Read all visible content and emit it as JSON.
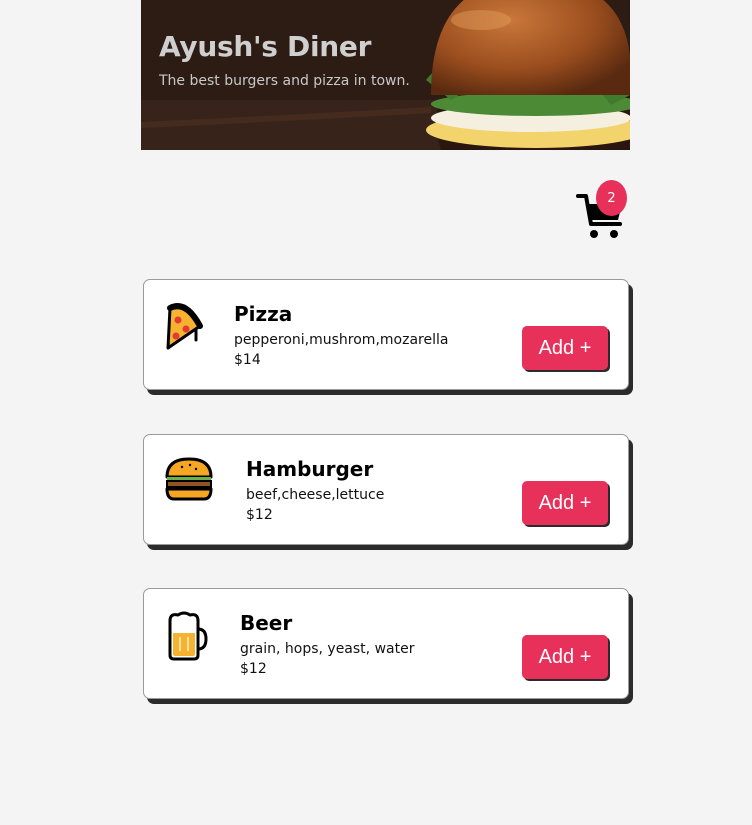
{
  "header": {
    "title": "Ayush's Diner",
    "subtitle": "The best burgers and pizza in town."
  },
  "cart": {
    "count": "2",
    "icon": "cart-icon"
  },
  "colors": {
    "accent": "#e8315a",
    "background": "#f4f4f4"
  },
  "menu": [
    {
      "name": "Pizza",
      "ingredients": "pepperoni,mushrom,mozarella",
      "price": "$14",
      "icon": "pizza-icon",
      "button": "Add +"
    },
    {
      "name": "Hamburger",
      "ingredients": "beef,cheese,lettuce",
      "price": "$12",
      "icon": "hamburger-icon",
      "button": "Add +"
    },
    {
      "name": "Beer",
      "ingredients": "grain, hops, yeast, water",
      "price": "$12",
      "icon": "beer-icon",
      "button": "Add +"
    }
  ]
}
